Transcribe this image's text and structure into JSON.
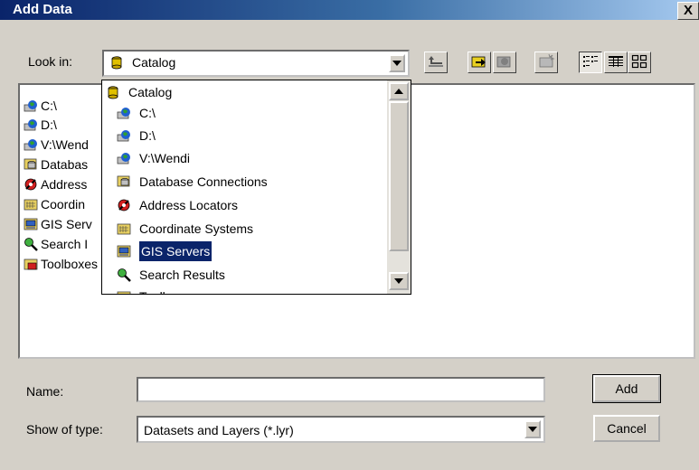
{
  "window": {
    "title": "Add Data",
    "close_label": "X"
  },
  "lookin": {
    "label": "Look in:",
    "value": "Catalog"
  },
  "toolbar": {
    "buttons": [
      "up-one-level-icon",
      "connect-folder-icon",
      "disconnect-folder-icon",
      "new-folder-icon",
      "list-view-icon",
      "details-view-icon",
      "thumbnails-view-icon"
    ]
  },
  "list": {
    "items": [
      {
        "label": "C:\\",
        "icon": "drive-globe-icon"
      },
      {
        "label": "D:\\",
        "icon": "drive-globe-icon"
      },
      {
        "label": "V:\\Wend",
        "icon": "drive-globe-icon"
      },
      {
        "label": "Databas",
        "icon": "database-icon"
      },
      {
        "label": "Address",
        "icon": "address-locator-icon"
      },
      {
        "label": "Coordin",
        "icon": "coordinate-systems-icon"
      },
      {
        "label": "GIS Serv",
        "icon": "gis-servers-icon"
      },
      {
        "label": "Search I",
        "icon": "search-results-icon"
      },
      {
        "label": "Toolboxes",
        "icon": "toolboxes-icon"
      }
    ]
  },
  "dropdown": {
    "items": [
      {
        "label": "Catalog",
        "icon": "catalog-icon"
      },
      {
        "label": "C:\\",
        "icon": "drive-globe-icon"
      },
      {
        "label": "D:\\",
        "icon": "drive-globe-icon"
      },
      {
        "label": "V:\\Wendi",
        "icon": "drive-globe-icon"
      },
      {
        "label": "Database Connections",
        "icon": "database-icon"
      },
      {
        "label": "Address Locators",
        "icon": "address-locator-icon"
      },
      {
        "label": "Coordinate Systems",
        "icon": "coordinate-systems-icon"
      },
      {
        "label": "GIS Servers",
        "icon": "gis-servers-icon"
      },
      {
        "label": "Search Results",
        "icon": "search-results-icon"
      },
      {
        "label": "Toolboxes",
        "icon": "toolboxes-icon"
      }
    ],
    "selected_index": 7
  },
  "form": {
    "name_label": "Name:",
    "name_value": "",
    "type_label": "Show of type:",
    "type_value": "Datasets and Layers (*.lyr)"
  },
  "buttons": {
    "add": "Add",
    "cancel": "Cancel"
  },
  "colors": {
    "title_bar": "#0a246a",
    "dialog_bg": "#d4d0c8",
    "selection": "#0a246a"
  }
}
